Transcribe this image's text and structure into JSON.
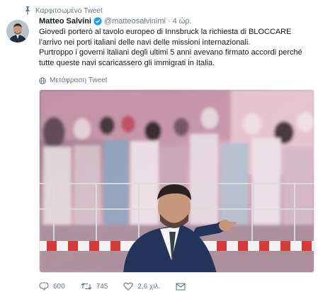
{
  "pinned": {
    "label": "Καρφιτσωμένο Tweet"
  },
  "tweet": {
    "author_name": "Matteo Salvini",
    "handle": "@matteosalvinimi",
    "separator": "·",
    "time": "4 ώρ.",
    "paragraphs": [
      "Giovedì porterò al tavolo europeo di Innsbruck la richiesta di BLOCCARE l’arrivo nei porti italiani delle navi delle missioni internazionali.",
      "Purtroppo i governi italiani degli ultimi 5 anni avevano firmato accordi perché tutte queste navi scaricassero gli immigrati in Italia."
    ],
    "translate_label": "Μετάφραση Tweet"
  },
  "actions": {
    "replies": "600",
    "retweets": "745",
    "likes": "2,6 χιλ."
  },
  "icons": {
    "pin": "pin-icon",
    "verified": "verified-badge-icon",
    "translate": "globe-icon",
    "reply": "reply-icon",
    "retweet": "retweet-icon",
    "like": "heart-icon",
    "message": "envelope-icon"
  },
  "colors": {
    "link_blue": "#1da1f2",
    "secondary_text": "#657786",
    "primary_text": "#14171a"
  }
}
